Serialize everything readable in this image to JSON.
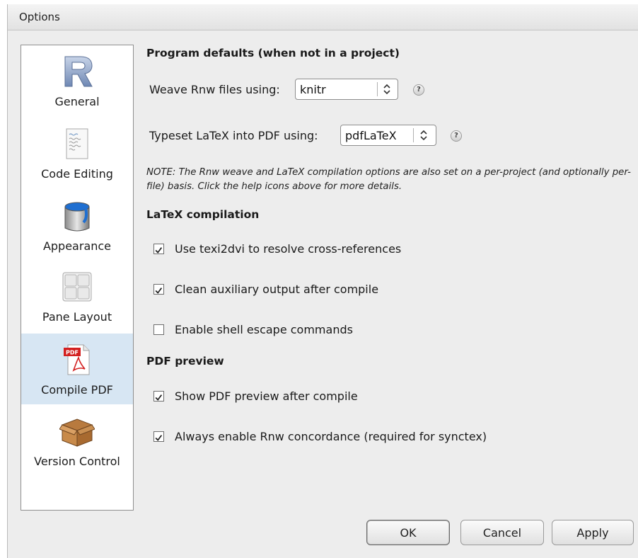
{
  "window": {
    "title": "Options"
  },
  "sidebar": {
    "items": [
      {
        "label": "General",
        "icon": "r-logo-icon"
      },
      {
        "label": "Code Editing",
        "icon": "code-document-icon"
      },
      {
        "label": "Appearance",
        "icon": "paint-bucket-icon"
      },
      {
        "label": "Pane Layout",
        "icon": "pane-grid-icon"
      },
      {
        "label": "Compile PDF",
        "icon": "pdf-icon",
        "selected": true
      },
      {
        "label": "Version Control",
        "icon": "box-icon"
      }
    ]
  },
  "program_defaults": {
    "title": "Program defaults (when not in a project)",
    "weave_label": "Weave Rnw files using:",
    "weave_value": "knitr",
    "typeset_label": "Typeset LaTeX into PDF using:",
    "typeset_value": "pdfLaTeX",
    "help_glyph": "?",
    "note": "NOTE: The Rnw weave and LaTeX compilation options are also set on a per-project (and optionally per-file) basis. Click the help icons above for more details."
  },
  "latex_compilation": {
    "title": "LaTeX compilation",
    "options": [
      {
        "label": "Use texi2dvi to resolve cross-references",
        "checked": true
      },
      {
        "label": "Clean auxiliary output after compile",
        "checked": true
      },
      {
        "label": "Enable shell escape commands",
        "checked": false
      }
    ]
  },
  "pdf_preview": {
    "title": "PDF preview",
    "options": [
      {
        "label": "Show PDF preview after compile",
        "checked": true
      },
      {
        "label": "Always enable Rnw concordance (required for synctex)",
        "checked": true
      }
    ]
  },
  "buttons": {
    "ok": "OK",
    "cancel": "Cancel",
    "apply": "Apply"
  },
  "colors": {
    "selected_nav": "#d7e6f3",
    "dialog_bg": "#ededed"
  }
}
